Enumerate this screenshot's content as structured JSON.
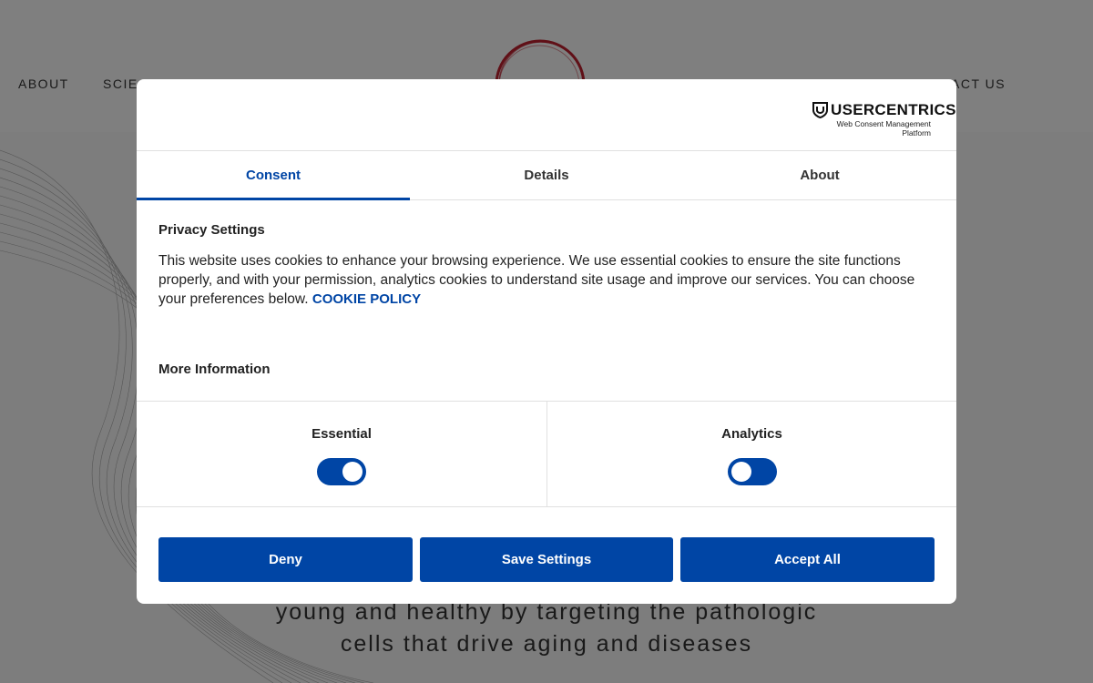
{
  "site": {
    "nav": {
      "about": "ABOUT",
      "science": "SCIE",
      "contact": "TACT US"
    },
    "hero_lines": [
      "young and healthy by targeting the pathologic",
      "cells that drive aging and diseases"
    ],
    "logo_color": "#c0202f"
  },
  "dialog": {
    "brand": {
      "name": "USERCENTRICS",
      "tagline": "Web Consent Management Platform"
    },
    "tabs": [
      {
        "label": "Consent",
        "active": true
      },
      {
        "label": "Details",
        "active": false
      },
      {
        "label": "About",
        "active": false
      }
    ],
    "privacy_title": "Privacy Settings",
    "privacy_text": "This website uses cookies to enhance your browsing experience. We use essential cookies to ensure the site functions properly, and with your permission, analytics cookies to understand site usage and improve our services. You can choose your preferences below.",
    "cookie_policy_link": "COOKIE POLICY",
    "more_info": "More Information",
    "toggles": [
      {
        "label": "Essential",
        "on": true
      },
      {
        "label": "Analytics",
        "on": false
      }
    ],
    "buttons": {
      "deny": "Deny",
      "save": "Save Settings",
      "accept": "Accept All"
    }
  },
  "colors": {
    "accent": "#0045a5",
    "overlay": "rgba(0,0,0,0.5)"
  }
}
